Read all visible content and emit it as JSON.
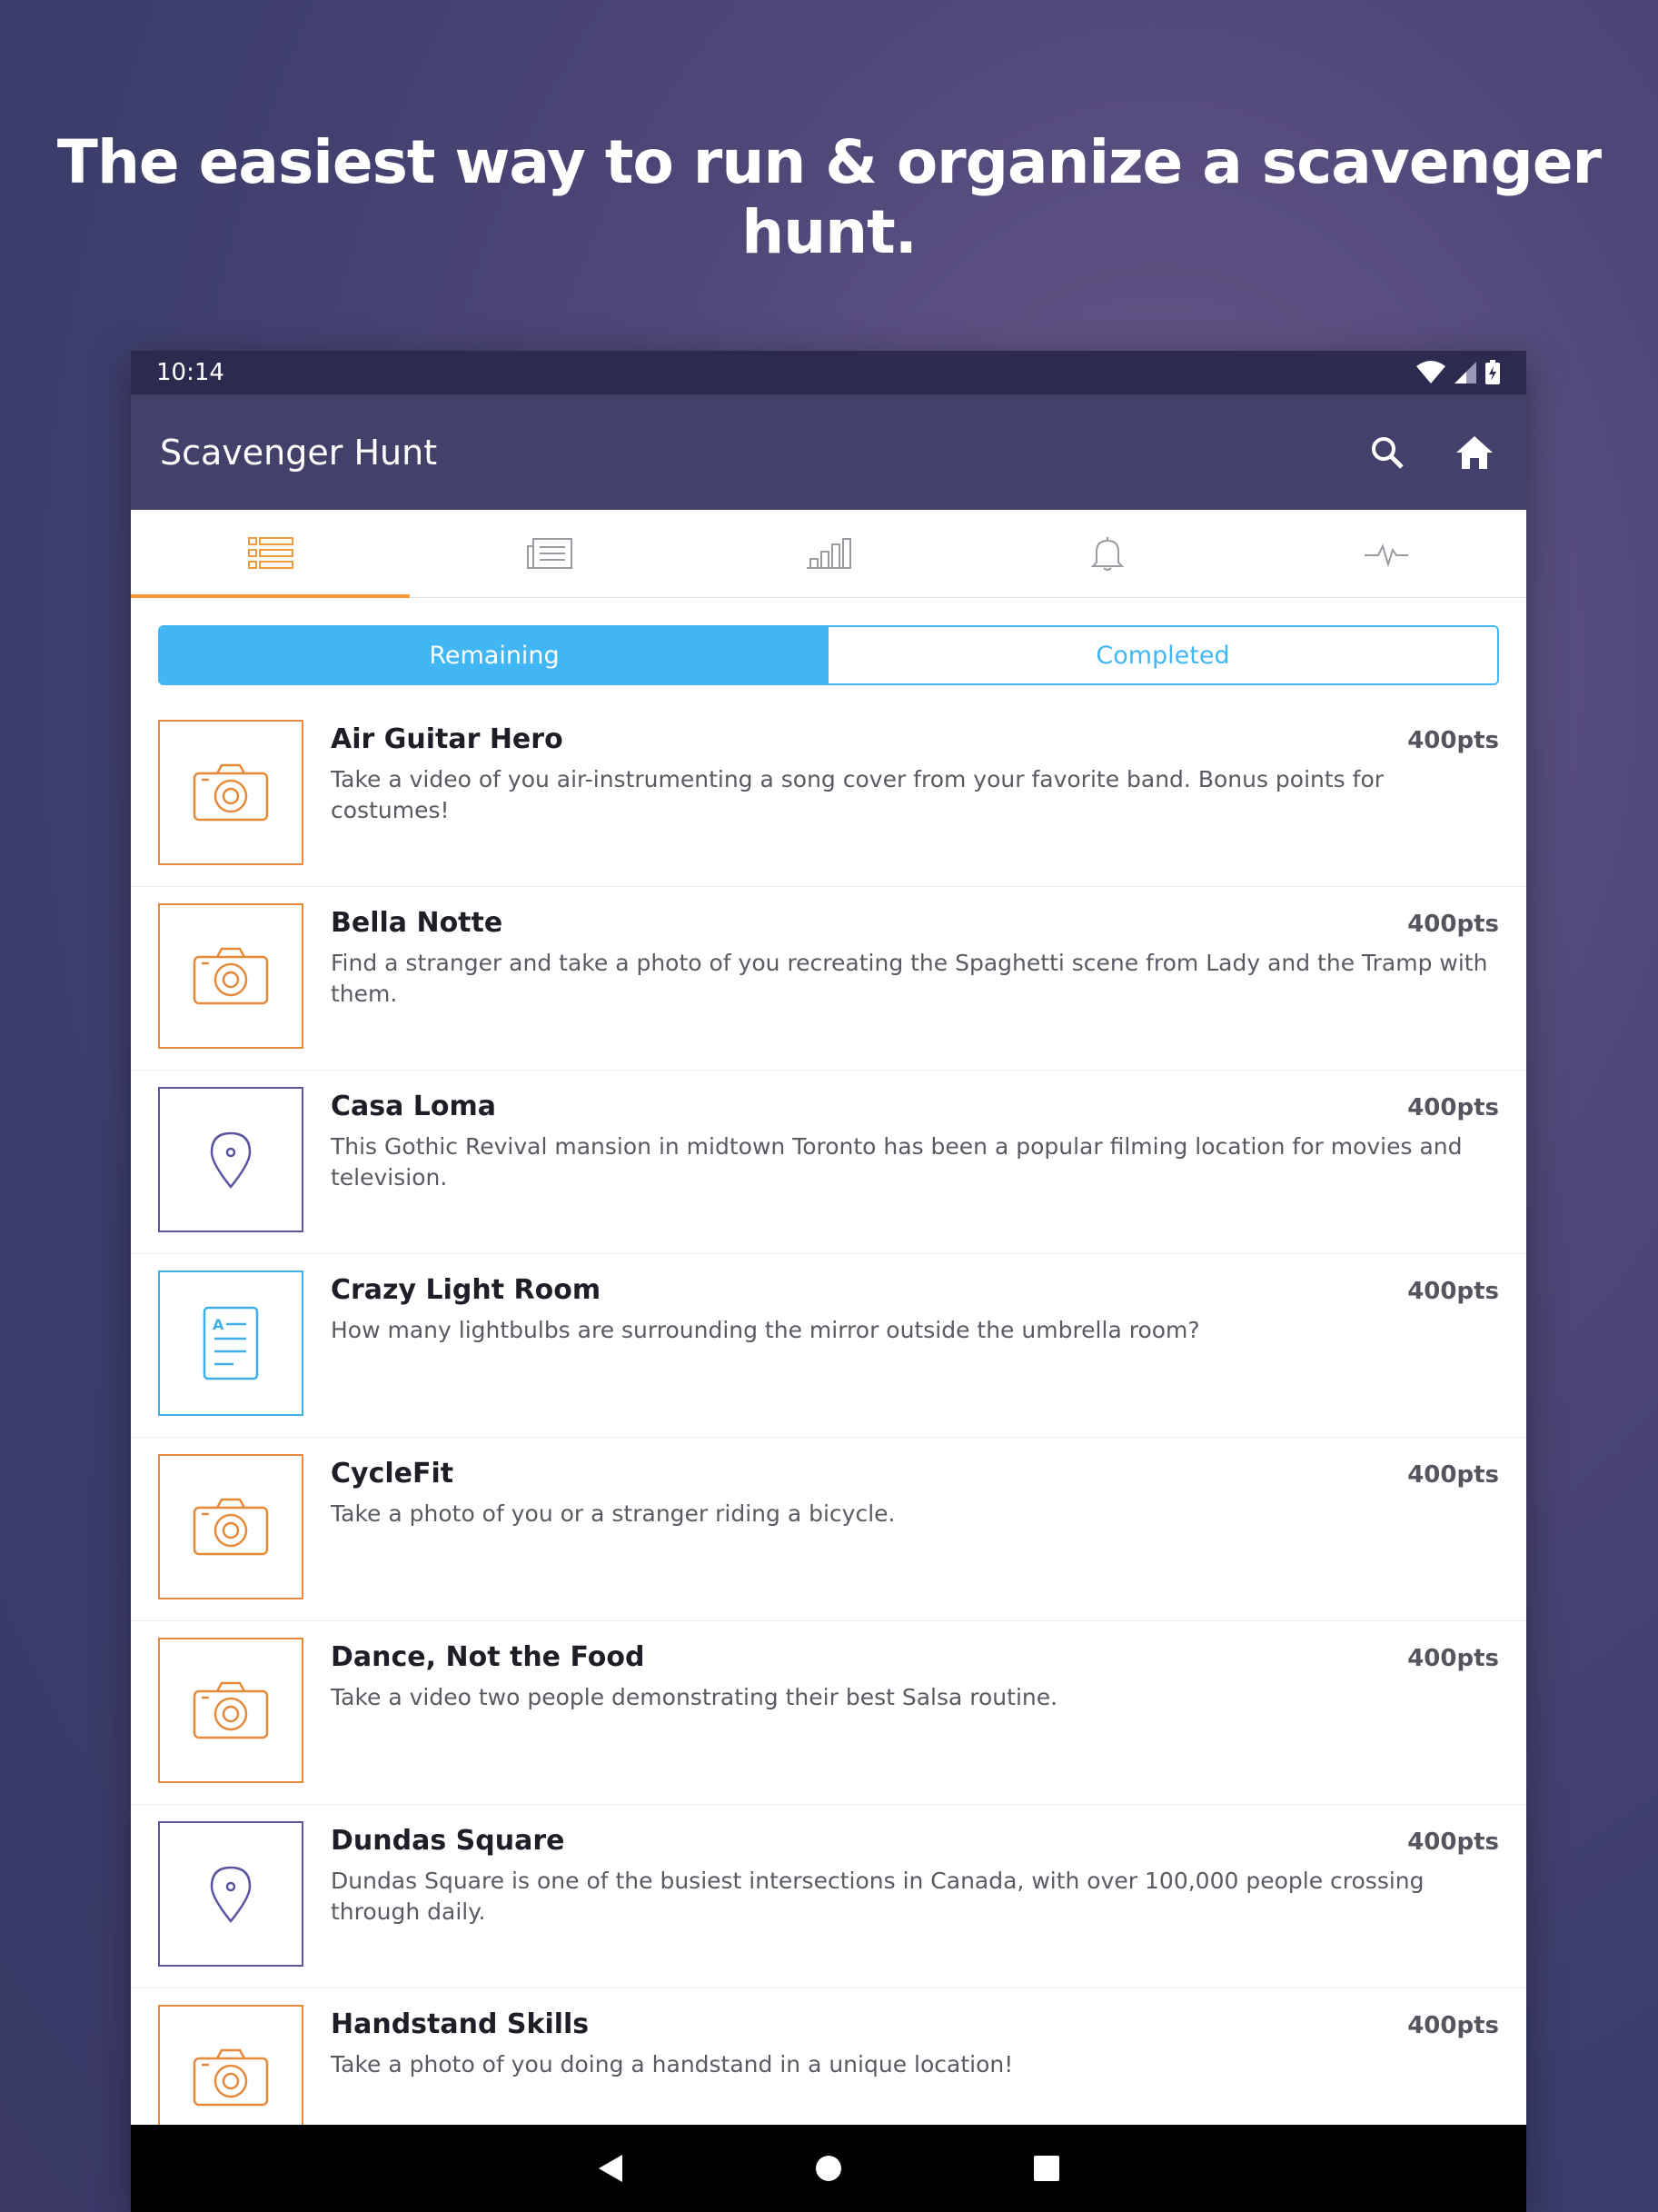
{
  "headline": "The easiest way to run & organize a scavenger hunt.",
  "status_bar": {
    "time": "10:14",
    "icons": [
      "wifi-icon",
      "signal-icon",
      "battery-charging-icon"
    ]
  },
  "app_bar": {
    "title": "Scavenger Hunt",
    "actions": [
      "search-icon",
      "home-icon"
    ]
  },
  "tabs": [
    {
      "icon": "list-icon",
      "active": true
    },
    {
      "icon": "news-icon",
      "active": false
    },
    {
      "icon": "bar-chart-icon",
      "active": false
    },
    {
      "icon": "bell-icon",
      "active": false
    },
    {
      "icon": "activity-icon",
      "active": false
    }
  ],
  "segment": {
    "remaining": "Remaining",
    "completed": "Completed",
    "selected": "Remaining"
  },
  "colors": {
    "accent_orange": "#f19a3e",
    "accent_blue": "#40b6f5",
    "app_bar": "#434169",
    "status_bar": "#2c2a4f",
    "location_purple": "#5a55a0"
  },
  "items": [
    {
      "title": "Air Guitar Hero",
      "points": "400pts",
      "type": "camera-icon",
      "description": "Take a video of you air-instrumenting a song cover from your favorite band. Bonus points for costumes!"
    },
    {
      "title": "Bella Notte",
      "points": "400pts",
      "type": "camera-icon",
      "description": "Find a stranger and take a photo of you recreating the Spaghetti scene from Lady and the Tramp with them."
    },
    {
      "title": "Casa Loma",
      "points": "400pts",
      "type": "location-pin-icon",
      "description": "This Gothic Revival mansion in midtown Toronto has been a popular filming location for movies and television."
    },
    {
      "title": "Crazy Light Room",
      "points": "400pts",
      "type": "text-document-icon",
      "description": "How many lightbulbs are surrounding the mirror outside the umbrella room?"
    },
    {
      "title": "CycleFit",
      "points": "400pts",
      "type": "camera-icon",
      "description": "Take a photo of you or a stranger riding a bicycle."
    },
    {
      "title": "Dance, Not the Food",
      "points": "400pts",
      "type": "camera-icon",
      "description": "Take a video two people demonstrating their best Salsa routine."
    },
    {
      "title": "Dundas Square",
      "points": "400pts",
      "type": "location-pin-icon",
      "description": "Dundas Square is one of the busiest intersections in Canada, with over 100,000 people crossing through daily."
    },
    {
      "title": "Handstand Skills",
      "points": "400pts",
      "type": "camera-icon",
      "description": "Take a photo of you doing a handstand in a unique location!"
    }
  ],
  "nav_bar": [
    "back-icon",
    "home-circle-icon",
    "recents-icon"
  ]
}
